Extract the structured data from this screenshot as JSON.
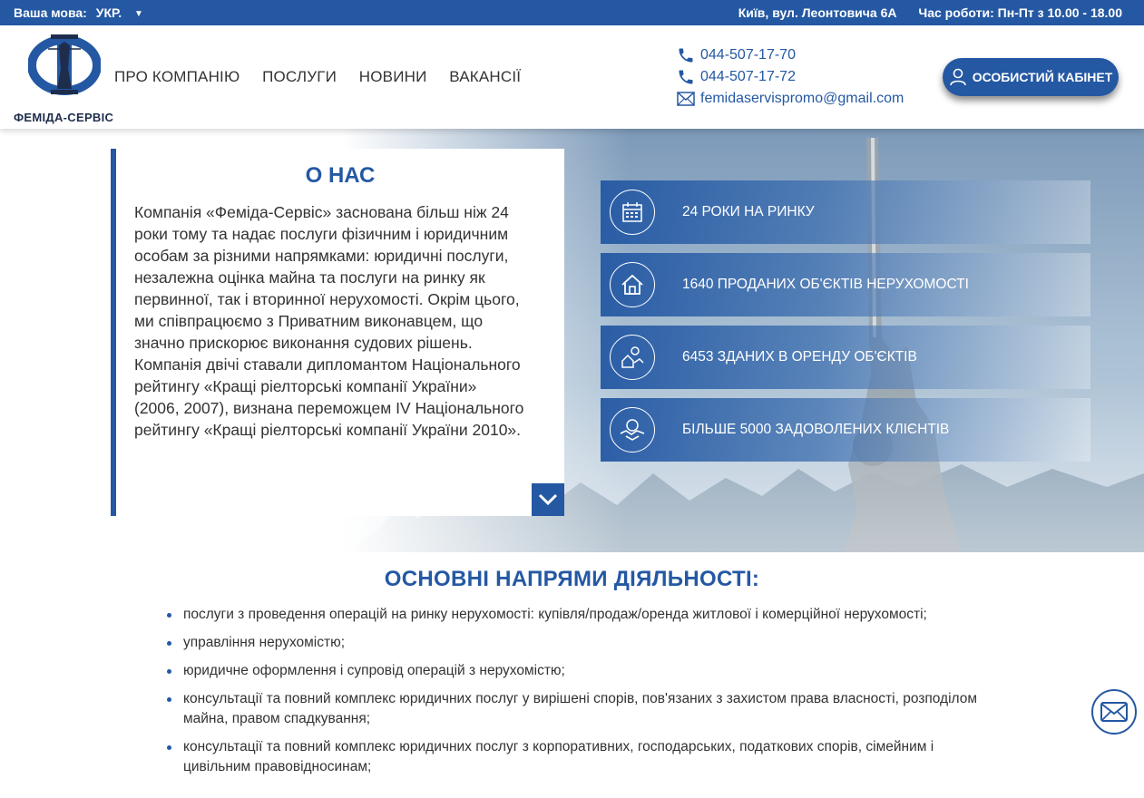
{
  "topbar": {
    "lang_label": "Ваша мова:",
    "lang_value": "УКР.",
    "address": "Київ, вул. Леонтовича 6А",
    "hours": "Час роботи: Пн-Пт з 10.00 - 18.00"
  },
  "header": {
    "brand": "ФЕМІДА-СЕРВІС",
    "nav": [
      "ПРО КОМПАНІЮ",
      "ПОСЛУГИ",
      "НОВИНИ",
      "ВАКАНСІЇ"
    ],
    "phone1": "044-507-17-70",
    "phone2": "044-507-17-72",
    "email": "femidaservispromo@gmail.com",
    "cabinet": "ОСОБИСТИЙ КАБІНЕТ"
  },
  "about": {
    "title": "О НАС",
    "text": "Компанія «Феміда-Сервіс» заснована більш ніж 24 роки тому та надає послуги фізичним і юридичним особам за різними напрямками: юридичні послуги, незалежна оцінка майна та послуги на ринку як первинної, так і вторинної нерухомості. Окрім цього, ми співпрацюємо з Приватним виконавцем, що значно прискорює виконання судових рішень. Компанія двічі ставали дипломантом Національного рейтингу «Кращі ріелторські компанії України» (2006, 2007), визнана переможцем IV Національного рейтингу «Кращі ріелторські компанії України 2010»."
  },
  "stats": [
    {
      "icon": "calendar-icon",
      "label": "24 РОКИ НА РИНКУ"
    },
    {
      "icon": "house-icon",
      "label": "1640 ПРОДАНИХ ОБ'ЄКТІВ НЕРУХОМОСТІ"
    },
    {
      "icon": "rent-icon",
      "label": "6453 ЗДАНИХ В ОРЕНДУ ОБ'ЄКТІВ"
    },
    {
      "icon": "handshake-icon",
      "label": "БІЛЬШЕ 5000 ЗАДОВОЛЕНИХ КЛІЄНТІВ"
    }
  ],
  "activities": {
    "title": "ОСНОВНІ НАПРЯМИ ДІЯЛЬНОСТІ:",
    "items": [
      "послуги з проведення операцій на ринку нерухомості: купівля/продаж/оренда житлової і комерційної нерухомості;",
      "управління нерухомістю;",
      "юридичне оформлення і супровід операцій з нерухомістю;",
      "консультації та повний комплекс юридичних послуг у вирішені спорів, пов'язаних з захистом права власності, розподілом майна, правом спадкування;",
      "консультації та повний комплекс юридичних послуг з корпоративних, господарських, податкових спорів, сімейним і цивільним правовідносинам;"
    ]
  },
  "colors": {
    "accent": "#2458a3",
    "text": "#333333"
  }
}
